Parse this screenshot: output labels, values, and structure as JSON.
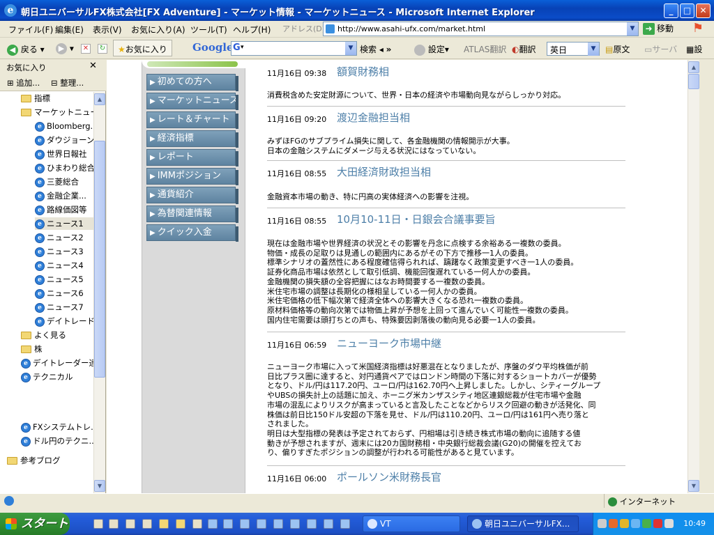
{
  "window": {
    "title": "朝日ユニバーサルFX株式会社[FX Adventure] - マーケット情報 - マーケットニュース - Microsoft Internet Explorer"
  },
  "menubar": {
    "items": [
      "ファイル(F)",
      "編集(E)",
      "表示(V)",
      "お気に入り(A)",
      "ツール(T)",
      "ヘルプ(H)"
    ],
    "address_label": "アドレス(D)",
    "url": "http://www.asahi-ufx.com/market.html",
    "go_label": "移動"
  },
  "toolbar": {
    "back": "戻る",
    "favorites": "お気に入り",
    "google": "Google",
    "google_prefix": "G",
    "search": "検索",
    "settings": "設定",
    "atlas": "ATLAS翻訳",
    "translate": "翻訳",
    "language": "英日",
    "original": "原文",
    "server": "サーバ",
    "settings2": "設"
  },
  "favorites_panel": {
    "title": "お気に入り",
    "add": "追加...",
    "organize": "整理...",
    "tree": [
      {
        "label": "指標",
        "type": "folder"
      },
      {
        "label": "マーケットニュース",
        "type": "folder"
      },
      {
        "label": "Bloomberg...",
        "type": "link"
      },
      {
        "label": "ダウジョーン...",
        "type": "link"
      },
      {
        "label": "世界日報社",
        "type": "link"
      },
      {
        "label": "ひまわり総合",
        "type": "link"
      },
      {
        "label": "三菱総合",
        "type": "link"
      },
      {
        "label": "金融企業...",
        "type": "link"
      },
      {
        "label": "路線価図等",
        "type": "link"
      },
      {
        "label": "ニュース1",
        "type": "link",
        "selected": true
      },
      {
        "label": "ニュース2",
        "type": "link"
      },
      {
        "label": "ニュース3",
        "type": "link"
      },
      {
        "label": "ニュース4",
        "type": "link"
      },
      {
        "label": "ニュース5",
        "type": "link"
      },
      {
        "label": "ニュース6",
        "type": "link"
      },
      {
        "label": "ニュース7",
        "type": "link"
      },
      {
        "label": "デイトレード...",
        "type": "link"
      },
      {
        "label": "よく見る",
        "type": "folder"
      },
      {
        "label": "株",
        "type": "folder"
      },
      {
        "label": "デイトレーダー達",
        "type": "link"
      },
      {
        "label": "テクニカル",
        "type": "link"
      },
      {
        "label": "FXシステムトレ...",
        "type": "link"
      },
      {
        "label": "ドル円のテクニ...",
        "type": "link"
      },
      {
        "label": "参考ブログ",
        "type": "folder"
      }
    ]
  },
  "site_nav": [
    "初めての方へ",
    "マーケットニュース",
    "レート＆チャート",
    "経済指標",
    "レポート",
    "IMMポジション",
    "通貨紹介",
    "為替関連情報",
    "クイック入金"
  ],
  "news": [
    {
      "time": "11月16日 09:38",
      "title": "額賀財務相",
      "body": [
        "消費税含めた安定財源について、世界・日本の経済や市場動向見ながらしっかり対応。"
      ]
    },
    {
      "time": "11月16日 09:20",
      "title": "渡辺金融担当相",
      "body": [
        "みずほFGのサブプライム損失に関して、各金融機関の情報開示が大事。",
        "日本の金融システムにダメージ与える状況にはなっていない。"
      ]
    },
    {
      "time": "11月16日 08:55",
      "title": "大田経済財政担当相",
      "body": [
        "金融資本市場の動き、特に円高の実体経済への影響を注視。"
      ]
    },
    {
      "time": "11月16日 08:55",
      "title": "10月10-11日・日銀会合議事要旨",
      "body": [
        "現在は金融市場や世界経済の状況とその影響を丹念に点検する余裕ある一複数の委員。",
        "物価・成長の足取りは見通しの範囲内にあるがその下方で推移一1人の委員。",
        "標準シナリオの蓋然性にある程度確信得られれば、躊躇なく政策変更すべき一1人の委員。",
        "証券化商品市場は依然として取引低調、機能回復遅れている一何人かの委員。",
        "金融機関の損失額の全容把握にはなお時間要する一複数の委員。",
        "米住宅市場の調整は長期化の様相呈している一何人かの委員。",
        "米住宅価格の低下幅次第で経済全体への影響大きくなる恐れ一複数の委員。",
        "原材料価格等の動向次第では物価上昇が予想を上回って進んでいく可能性一複数の委員。",
        "国内住宅需要は頭打ちとの声も、特殊要因剥落後の動向見る必要一1人の委員。"
      ]
    },
    {
      "time": "11月16日 06:59",
      "title": "ニューヨーク市場中継",
      "body": [
        "ニューヨーク市場に入って米国経済指標は好悪混在となりましたが、序盤のダウ平均株価が前",
        "日比プラス圏に達すると、対円通貨ペアではロンドン時間の下落に対するショートカバーが優勢",
        "となり、ドル/円は117.20円、ユーロ/円は162.70円へ上昇しました。しかし、シティーグループ",
        "やUBSの損失計上の話題に加え、ホーニグ米カンザスシティ地区連銀総裁が住宅市場や金融",
        "市場の混乱によりリスクが高まっていると言及したことなどからリスク回避の動きが活発化、同",
        "株価は前日比150ドル安超の下落を見せ、ドル/円は110.20円、ユーロ/円は161円へ売り落と",
        "されました。",
        "明日は大型指標の発表は予定されておらず、円相場は引き続き株式市場の動向に追随する値",
        "動きが予想されますが、週末には20カ国財務相・中央銀行総裁会議(G20)の開催を控えてお",
        "り、偏りすぎたポジションの調整が行われる可能性があると見ています。"
      ]
    },
    {
      "time": "11月16日 06:00",
      "title": "ポールソン米財務長官",
      "body": []
    }
  ],
  "statusbar": {
    "zone": "インターネット"
  },
  "taskbar": {
    "start": "スタート",
    "tasks": [
      "VT",
      "朝日ユニバーサルFX..."
    ],
    "clock": "10:49"
  },
  "colors": {
    "title_blue": "#0a4cc8",
    "nav_button": "#6f92ad",
    "headline": "#4d7fa8"
  }
}
